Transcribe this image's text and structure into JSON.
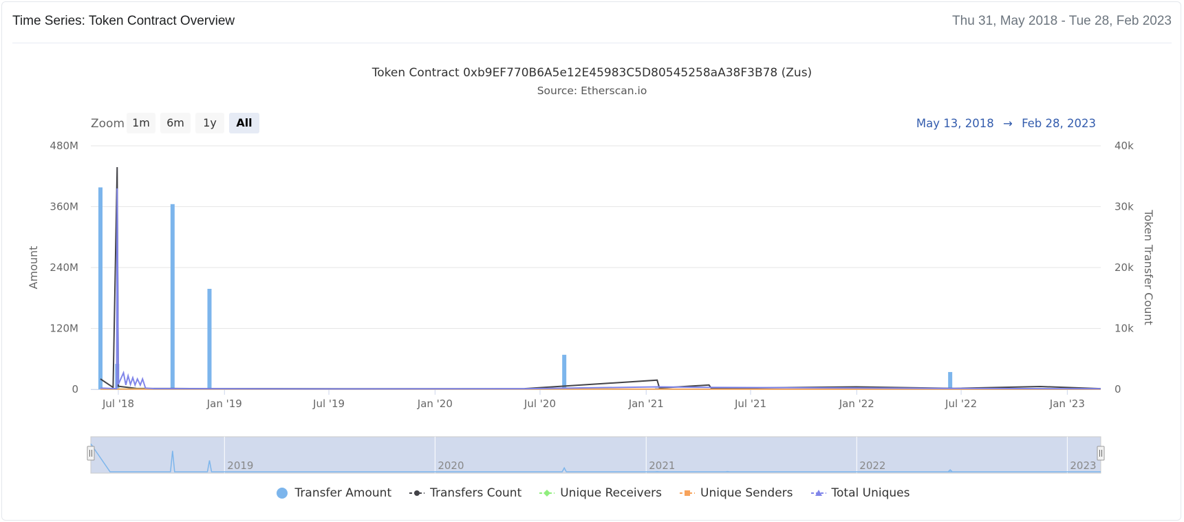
{
  "header": {
    "title": "Time Series: Token Contract Overview",
    "date_range": "Thu 31, May 2018 - Tue 28, Feb 2023"
  },
  "chart_data": {
    "type": "bar",
    "title": "Token Contract 0xb9EF770B6A5e12E45983C5D80545258aA38F3B78 (Zus)",
    "subtitle": "Source: Etherscan.io",
    "zoom": {
      "label": "Zoom",
      "buttons": [
        "1m",
        "6m",
        "1y",
        "All"
      ],
      "active": "All"
    },
    "range_selector": {
      "from": "May 13, 2018",
      "arrow": "→",
      "to": "Feb 28, 2023"
    },
    "x_range": [
      "2018-05-31",
      "2023-02-28"
    ],
    "x_ticks": [
      "Jul '18",
      "Jan '19",
      "Jul '19",
      "Jan '20",
      "Jul '20",
      "Jan '21",
      "Jul '21",
      "Jan '22",
      "Jul '22",
      "Jan '23"
    ],
    "x_tick_dates": [
      "2018-07-01",
      "2019-01-01",
      "2019-07-01",
      "2020-01-01",
      "2020-07-01",
      "2021-01-01",
      "2021-07-01",
      "2022-01-01",
      "2022-07-01",
      "2023-01-01"
    ],
    "y_left": {
      "label": "Amount",
      "min": 0,
      "max": 480000000,
      "ticks": [
        "0",
        "120M",
        "240M",
        "360M",
        "480M"
      ]
    },
    "y_right": {
      "label": "Token Transfer Count",
      "min": 0,
      "max": 40000,
      "ticks": [
        "0",
        "10k",
        "20k",
        "30k",
        "40k"
      ]
    },
    "grid": true,
    "legend_position": "bottom",
    "navigator_years": [
      "2019",
      "2020",
      "2021",
      "2022",
      "2023"
    ],
    "series": [
      {
        "name": "Transfer Amount",
        "type": "bar",
        "axis": "left",
        "color": "#7cb5ec",
        "points": [
          [
            "2018-05-31",
            398000000
          ],
          [
            "2018-06-29",
            50000000
          ],
          [
            "2018-10-03",
            365000000
          ],
          [
            "2018-12-06",
            198000000
          ],
          [
            "2020-08-12",
            68000000
          ],
          [
            "2021-05-22",
            4000000
          ],
          [
            "2022-06-12",
            34000000
          ],
          [
            "2021-01-20",
            2500000
          ]
        ]
      },
      {
        "name": "Transfers Count",
        "type": "line",
        "axis": "right",
        "color": "#434348",
        "points": [
          [
            "2018-05-31",
            1700
          ],
          [
            "2018-06-22",
            300
          ],
          [
            "2018-06-29",
            36500
          ],
          [
            "2018-07-01",
            500
          ],
          [
            "2018-08-01",
            150
          ],
          [
            "2018-12-01",
            100
          ],
          [
            "2020-06-01",
            80
          ],
          [
            "2021-01-20",
            1500
          ],
          [
            "2021-01-24",
            200
          ],
          [
            "2021-04-20",
            700
          ],
          [
            "2021-04-24",
            150
          ],
          [
            "2021-12-31",
            400
          ],
          [
            "2022-06-20",
            150
          ],
          [
            "2022-11-15",
            450
          ],
          [
            "2023-02-28",
            100
          ]
        ]
      },
      {
        "name": "Unique Receivers",
        "type": "line",
        "axis": "right",
        "color": "#90ed7d",
        "points": [
          [
            "2018-05-31",
            40
          ],
          [
            "2023-02-28",
            20
          ]
        ]
      },
      {
        "name": "Unique Senders",
        "type": "line",
        "axis": "right",
        "color": "#f7a35c",
        "points": [
          [
            "2018-05-31",
            30
          ],
          [
            "2023-02-28",
            15
          ]
        ]
      },
      {
        "name": "Total Uniques",
        "type": "line",
        "axis": "right",
        "color": "#8085e9",
        "points": [
          [
            "2018-05-31",
            200
          ],
          [
            "2018-06-28",
            100
          ],
          [
            "2018-06-29",
            33000
          ],
          [
            "2018-07-01",
            800
          ],
          [
            "2018-07-10",
            2700
          ],
          [
            "2018-07-14",
            700
          ],
          [
            "2018-07-18",
            2200
          ],
          [
            "2018-07-22",
            800
          ],
          [
            "2018-07-26",
            1900
          ],
          [
            "2018-07-30",
            700
          ],
          [
            "2018-08-03",
            1700
          ],
          [
            "2018-08-08",
            700
          ],
          [
            "2018-08-12",
            1700
          ],
          [
            "2018-08-17",
            200
          ],
          [
            "2018-09-01",
            100
          ],
          [
            "2019-06-01",
            60
          ],
          [
            "2020-06-01",
            80
          ],
          [
            "2021-01-20",
            400
          ],
          [
            "2021-04-20",
            300
          ],
          [
            "2022-06-01",
            150
          ],
          [
            "2023-02-28",
            80
          ]
        ]
      }
    ]
  }
}
